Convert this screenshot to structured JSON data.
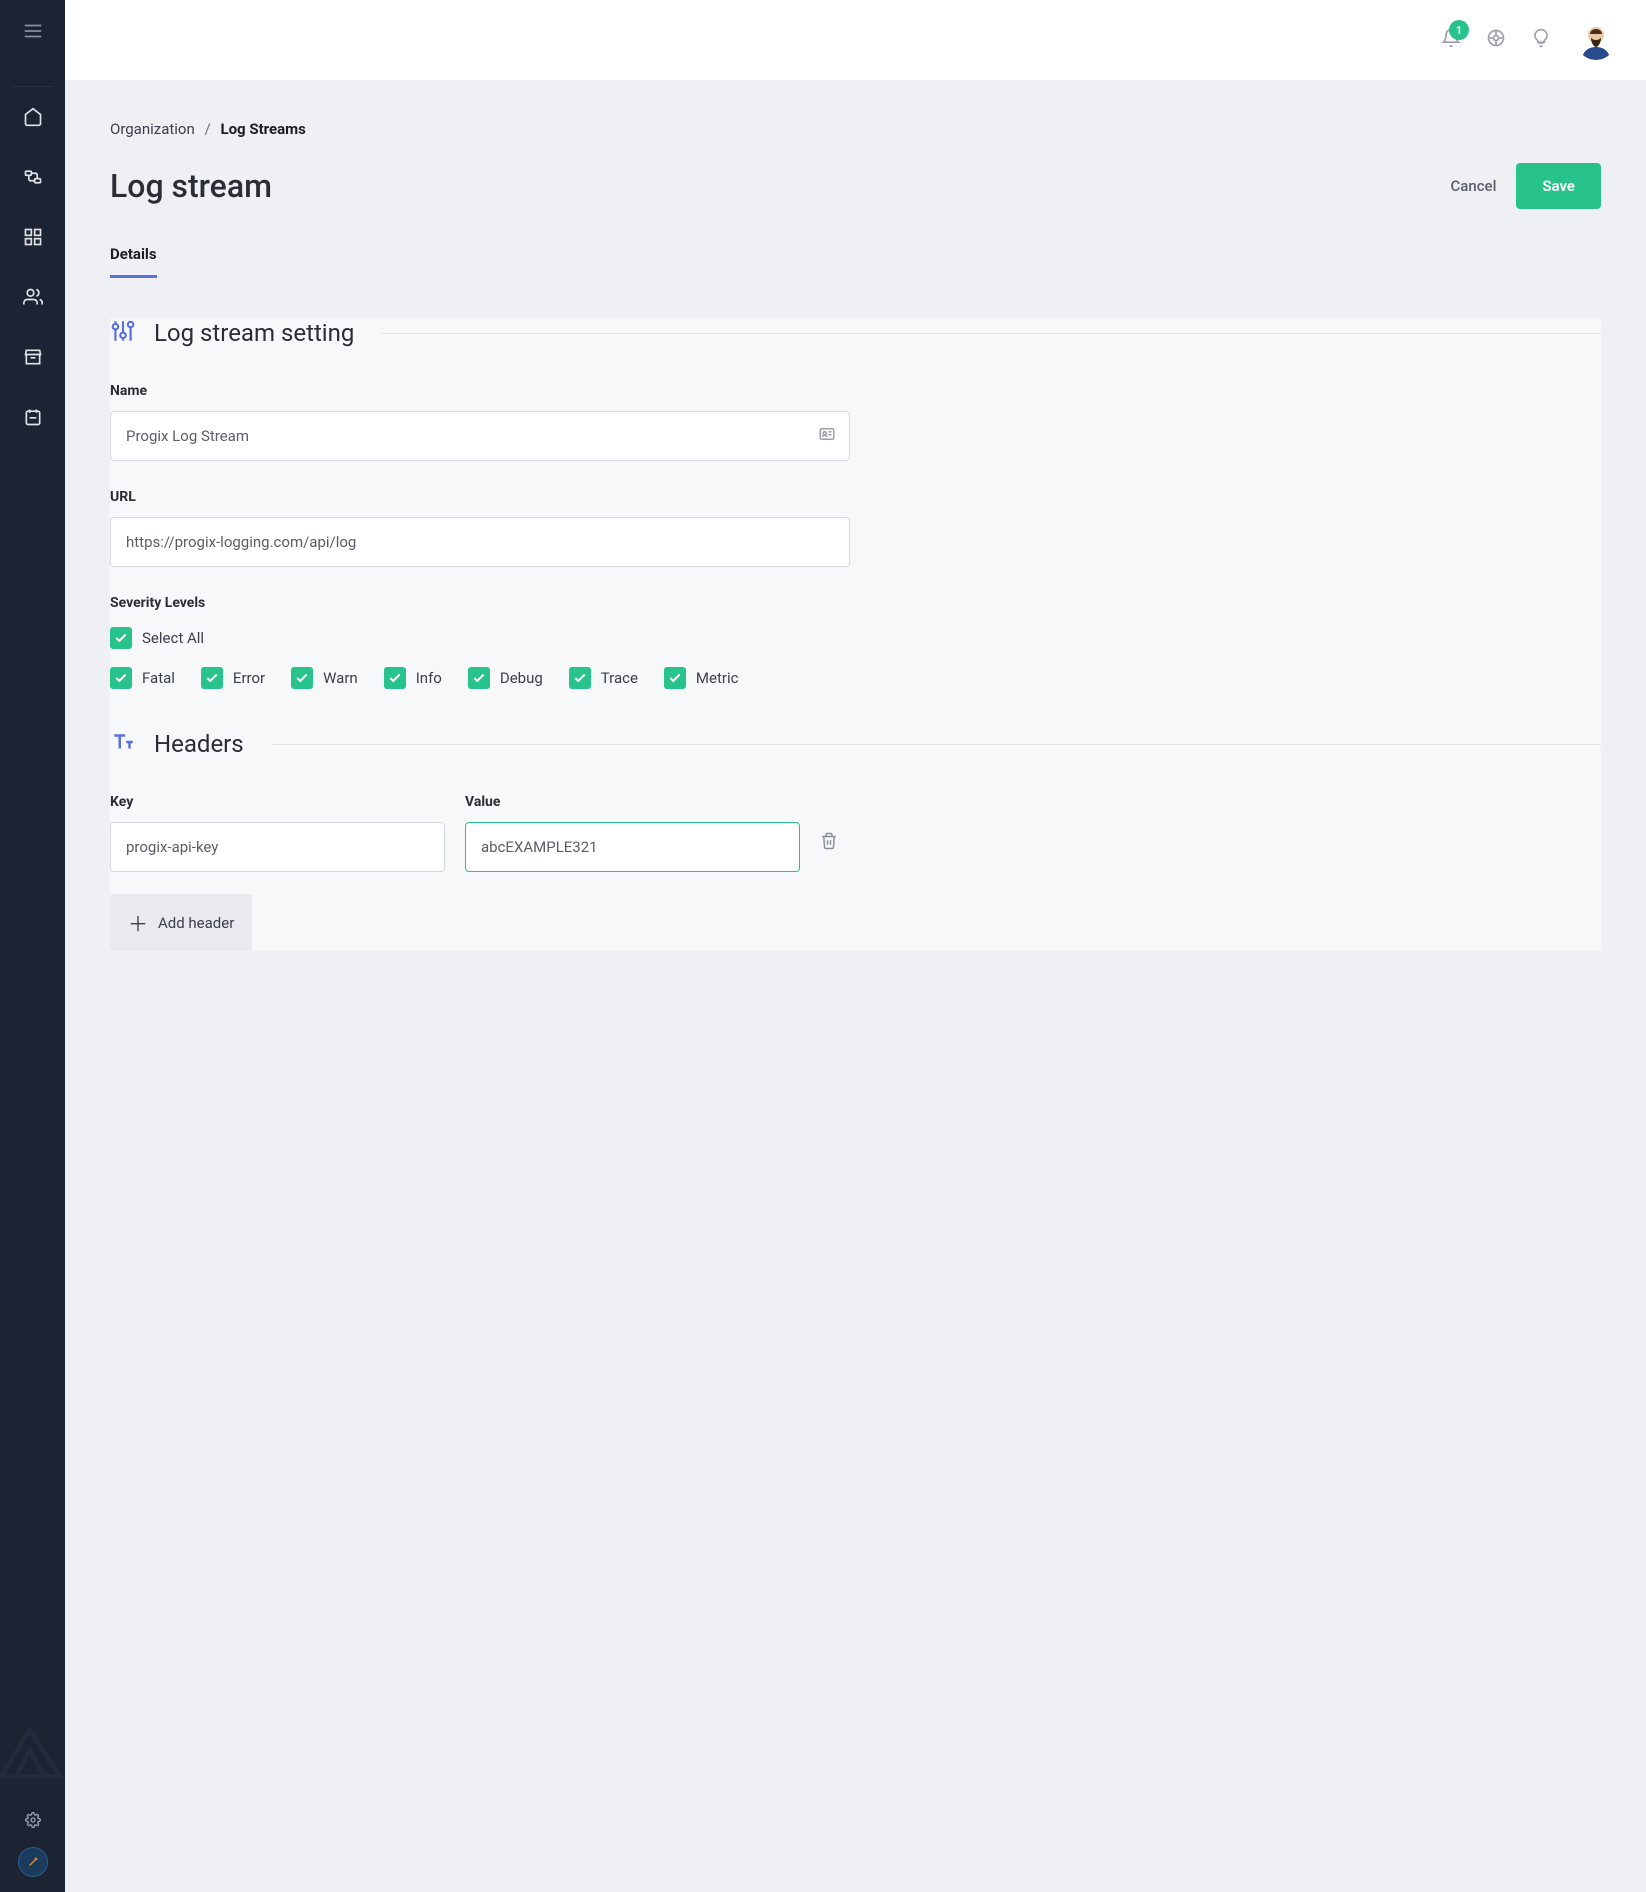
{
  "topbar": {
    "notification_count": "1"
  },
  "breadcrumb": {
    "parent": "Organization",
    "sep": "/",
    "current": "Log Streams"
  },
  "header": {
    "title": "Log stream",
    "cancel": "Cancel",
    "save": "Save"
  },
  "tabs": {
    "details": "Details"
  },
  "sections": {
    "settings_title": "Log stream setting",
    "headers_title": "Headers"
  },
  "fields": {
    "name_label": "Name",
    "name_value": "Progix Log Stream",
    "url_label": "URL",
    "url_value": "https://progix-logging.com/api/log",
    "severity_label": "Severity Levels",
    "select_all": "Select All"
  },
  "severity": [
    {
      "label": "Fatal"
    },
    {
      "label": "Error"
    },
    {
      "label": "Warn"
    },
    {
      "label": "Info"
    },
    {
      "label": "Debug"
    },
    {
      "label": "Trace"
    },
    {
      "label": "Metric"
    }
  ],
  "headers": {
    "key_label": "Key",
    "value_label": "Value",
    "rows": [
      {
        "key": "progix-api-key",
        "value": "abcEXAMPLE321"
      }
    ],
    "add": "Add header"
  }
}
